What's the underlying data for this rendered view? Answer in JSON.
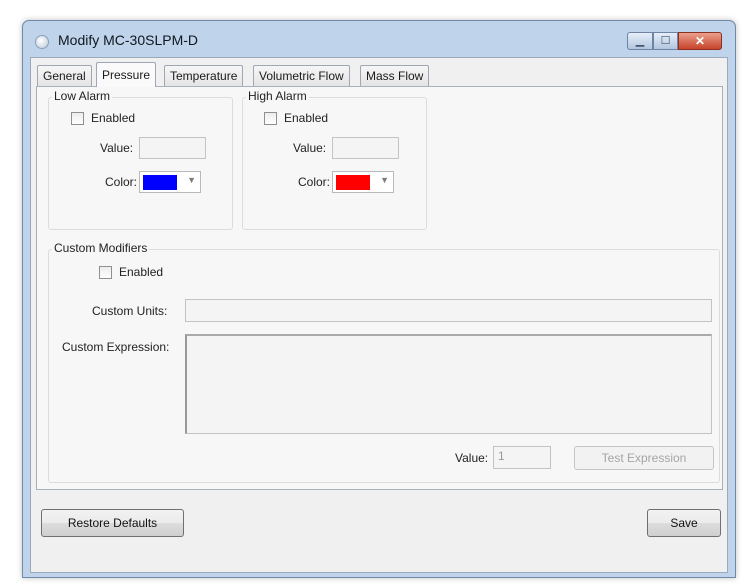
{
  "window": {
    "title": "Modify MC-30SLPM-D"
  },
  "tabs": [
    {
      "label": "General"
    },
    {
      "label": "Pressure"
    },
    {
      "label": "Temperature"
    },
    {
      "label": "Volumetric Flow"
    },
    {
      "label": "Mass Flow"
    }
  ],
  "active_tab": "Pressure",
  "low_alarm": {
    "title": "Low Alarm",
    "enabled_label": "Enabled",
    "enabled": false,
    "value_label": "Value:",
    "value": "",
    "color_label": "Color:",
    "color": "#0000ff"
  },
  "high_alarm": {
    "title": "High Alarm",
    "enabled_label": "Enabled",
    "enabled": false,
    "value_label": "Value:",
    "value": "",
    "color_label": "Color:",
    "color": "#ff0000"
  },
  "custom_modifiers": {
    "title": "Custom Modifiers",
    "enabled_label": "Enabled",
    "enabled": false,
    "units_label": "Custom Units:",
    "units_value": "",
    "expression_label": "Custom Expression:",
    "expression_value": "",
    "value_label": "Value:",
    "value": "1",
    "test_button": "Test Expression"
  },
  "buttons": {
    "restore_defaults": "Restore Defaults",
    "save": "Save"
  },
  "icons": {
    "app": "app-icon",
    "minimize": "minimize-icon",
    "maximize": "maximize-icon",
    "close": "close-icon",
    "dropdown": "chevron-down-icon"
  }
}
